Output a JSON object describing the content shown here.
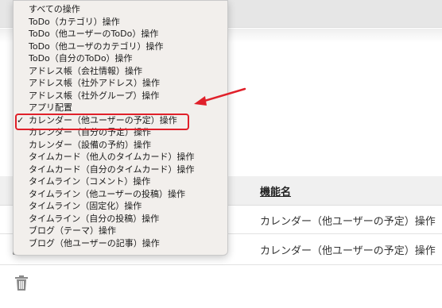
{
  "dropdown": {
    "items": [
      {
        "label": "すべての操作"
      },
      {
        "label": "ToDo（カテゴリ）操作"
      },
      {
        "label": "ToDo（他ユーザーのToDo）操作"
      },
      {
        "label": "ToDo（他ユーザのカテゴリ）操作"
      },
      {
        "label": "ToDo（自分のToDo）操作"
      },
      {
        "label": "アドレス帳（会社情報）操作"
      },
      {
        "label": "アドレス帳（社外アドレス）操作"
      },
      {
        "label": "アドレス帳（社外グループ）操作"
      },
      {
        "label": "アプリ配置"
      },
      {
        "label": "カレンダー（他ユーザーの予定）操作",
        "selected": true,
        "check": "✓"
      },
      {
        "label": "カレンダー（自分の予定）操作"
      },
      {
        "label": "カレンダー（設備の予約）操作"
      },
      {
        "label": "タイムカード（他人のタイムカード）操作"
      },
      {
        "label": "タイムカード（自分のタイムカード）操作"
      },
      {
        "label": "タイムライン（コメント）操作"
      },
      {
        "label": "タイムライン（他ユーザーの投稿）操作"
      },
      {
        "label": "タイムライン（固定化）操作"
      },
      {
        "label": "タイムライン（自分の投稿）操作"
      },
      {
        "label": "ブログ（テーマ）操作"
      },
      {
        "label": "ブログ（他ユーザーの記事）操作"
      }
    ]
  },
  "table": {
    "header_function_name": "機能名",
    "rows": [
      {
        "function_name": "カレンダー（他ユーザーの予定）操作"
      },
      {
        "function_name": "カレンダー（他ユーザーの予定）操作"
      }
    ]
  },
  "colors": {
    "highlight": "#e0202a",
    "arrow": "#e0202a"
  },
  "icons": {
    "delete": "trash-icon",
    "selected_mark": "checkmark-icon"
  }
}
